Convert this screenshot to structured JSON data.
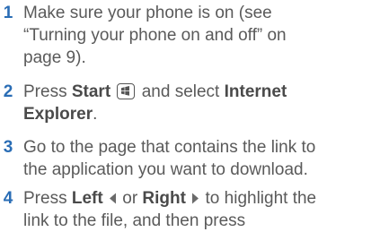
{
  "steps": [
    {
      "number": "1",
      "line1": "Make sure your phone is on (see",
      "line2": "“Turning your phone on and off” on",
      "line3": "page 9)."
    },
    {
      "number": "2",
      "pre": "Press ",
      "start_label": "Start",
      "mid": " and select ",
      "internet_label": "Internet",
      "explorer_label": "Explorer",
      "end": ".",
      "icon": "windows-start-icon"
    },
    {
      "number": "3",
      "line1": "Go to the page that contains the link to",
      "line2": "the application you want to download."
    },
    {
      "number": "4",
      "pre": "Press ",
      "left_label": "Left",
      "or_text": " or ",
      "right_label": "Right",
      "post": " to highlight the",
      "line2": "link to the file, and then press",
      "icons": [
        "left-arrow-icon",
        "right-arrow-icon"
      ]
    }
  ]
}
